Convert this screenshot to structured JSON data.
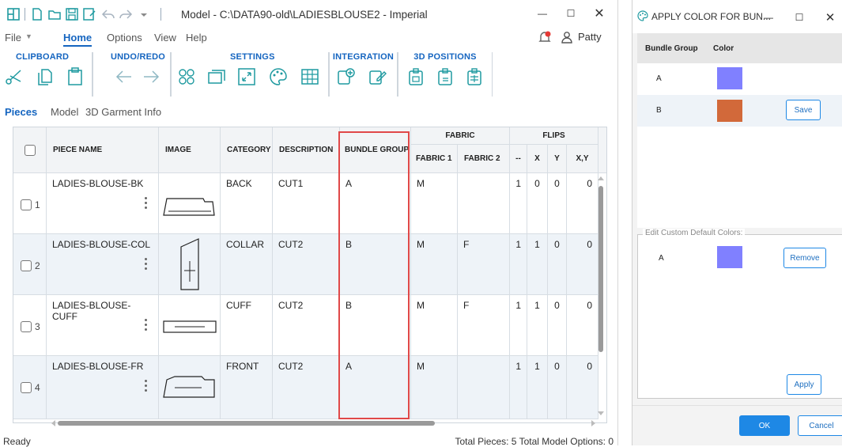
{
  "window": {
    "title": "Model - C:\\DATA90-old\\LADIESBLOUSE2 - Imperial",
    "controls": {
      "minimize": "—",
      "maximize": "☐",
      "close": "✕"
    }
  },
  "menu": {
    "items": [
      "File",
      "Home",
      "Options",
      "View",
      "Help"
    ],
    "user": "Patty"
  },
  "ribbon": {
    "groups": [
      {
        "label": "CLIPBOARD",
        "icons": [
          "cut-icon",
          "copy-icon",
          "paste-icon"
        ]
      },
      {
        "label": "UNDO/REDO",
        "icons": [
          "undo-icon",
          "redo-icon"
        ]
      },
      {
        "label": "SETTINGS",
        "icons": [
          "settings-circles-icon",
          "images-icon",
          "resize-icon",
          "color-palette-icon",
          "grid-table-icon"
        ]
      },
      {
        "label": "INTEGRATION",
        "icons": [
          "integration-add-icon",
          "integration-edit-icon"
        ]
      },
      {
        "label": "3D POSITIONS",
        "icons": [
          "position-copy-icon",
          "position-paste-icon",
          "position-table-icon"
        ]
      }
    ]
  },
  "tabs": [
    "Pieces",
    "Model",
    "3D Garment Info"
  ],
  "table": {
    "headers": {
      "piece_name": "PIECE NAME",
      "image": "IMAGE",
      "category": "CATEGORY",
      "description": "DESCRIPTION",
      "bundle_group": "BUNDLE GROUP",
      "fabric": "FABRIC",
      "fabric1": "FABRIC 1",
      "fabric2": "FABRIC 2",
      "flips": "FLIPS",
      "flip_none": "--",
      "flip_x": "X",
      "flip_y": "Y",
      "flip_xy": "X,Y"
    },
    "rows": [
      {
        "num": "1",
        "name": "LADIES-BLOUSE-BK",
        "category": "BACK",
        "description": "CUT1",
        "bundle": "A",
        "fabric1": "M",
        "fabric2": "",
        "f0": "1",
        "fx": "0",
        "fy": "0",
        "fxy": "0",
        "shape": "back"
      },
      {
        "num": "2",
        "name": "LADIES-BLOUSE-COL",
        "category": "COLLAR",
        "description": "CUT2",
        "bundle": "B",
        "fabric1": "M",
        "fabric2": "F",
        "f0": "1",
        "fx": "1",
        "fy": "0",
        "fxy": "0",
        "shape": "collar"
      },
      {
        "num": "3",
        "name": "LADIES-BLOUSE-CUFF",
        "category": "CUFF",
        "description": "CUT2",
        "bundle": "B",
        "fabric1": "M",
        "fabric2": "F",
        "f0": "1",
        "fx": "1",
        "fy": "0",
        "fxy": "0",
        "shape": "cuff"
      },
      {
        "num": "4",
        "name": "LADIES-BLOUSE-FR",
        "category": "FRONT",
        "description": "CUT2",
        "bundle": "A",
        "fabric1": "M",
        "fabric2": "",
        "f0": "1",
        "fx": "1",
        "fy": "0",
        "fxy": "0",
        "shape": "front"
      }
    ]
  },
  "status": {
    "left": "Ready",
    "right": "Total Pieces: 5   Total Model Options: 0"
  },
  "dialog": {
    "title": "APPLY COLOR FOR BUN...",
    "controls": {
      "minimize": "—",
      "maximize": "☐",
      "close": "✕"
    },
    "headers": {
      "bundle_group": "Bundle Group",
      "color": "Color"
    },
    "groups": [
      {
        "name": "A",
        "color": "#8080ff"
      },
      {
        "name": "B",
        "color": "#d2693a"
      }
    ],
    "save_label": "Save",
    "custom_legend": "Edit Custom Default Colors:",
    "custom": [
      {
        "name": "A",
        "color": "#8080ff"
      }
    ],
    "remove_label": "Remove",
    "apply_label": "Apply",
    "ok_label": "OK",
    "cancel_label": "Cancel"
  }
}
